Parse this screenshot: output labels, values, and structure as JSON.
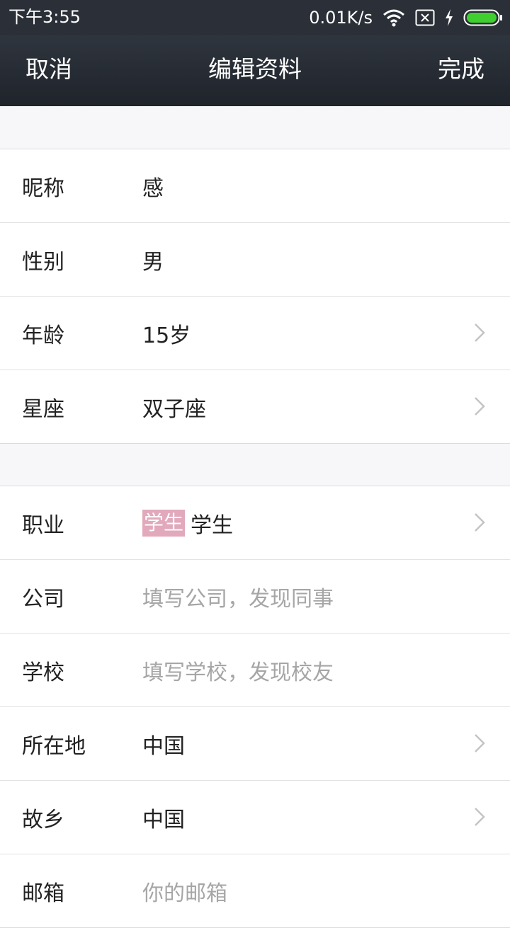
{
  "status_bar": {
    "time": "下午3:55",
    "network_speed": "0.01K/s",
    "icons": [
      "wifi-icon",
      "sim-off-icon",
      "charging-icon",
      "battery-icon"
    ]
  },
  "nav": {
    "cancel_label": "取消",
    "title": "编辑资料",
    "done_label": "完成"
  },
  "groups": [
    {
      "rows": [
        {
          "label": "昵称",
          "value": "感",
          "placeholder": false,
          "chevron": false
        },
        {
          "label": "性别",
          "value": "男",
          "placeholder": false,
          "chevron": false
        },
        {
          "label": "年龄",
          "value": "15岁",
          "placeholder": false,
          "chevron": true
        },
        {
          "label": "星座",
          "value": "双子座",
          "placeholder": false,
          "chevron": true
        }
      ]
    },
    {
      "rows": [
        {
          "label": "职业",
          "tag": "学生",
          "value": "学生",
          "placeholder": false,
          "chevron": true
        },
        {
          "label": "公司",
          "value": "填写公司，发现同事",
          "placeholder": true,
          "chevron": false
        },
        {
          "label": "学校",
          "value": "填写学校，发现校友",
          "placeholder": true,
          "chevron": false
        },
        {
          "label": "所在地",
          "value": "中国",
          "placeholder": false,
          "chevron": true
        },
        {
          "label": "故乡",
          "value": "中国",
          "placeholder": false,
          "chevron": true
        },
        {
          "label": "邮箱",
          "value": "你的邮箱",
          "placeholder": true,
          "chevron": false
        }
      ]
    }
  ],
  "colors": {
    "status_bar_bg": "#2b3038",
    "nav_bg": "#23282f",
    "page_bg": "#f7f7f9",
    "placeholder_text": "#a6a6a6",
    "tag_bg": "#e1a9bb"
  }
}
